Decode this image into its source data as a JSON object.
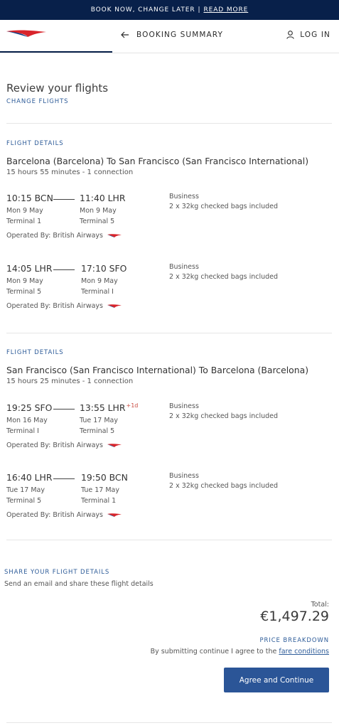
{
  "banner": {
    "text": "BOOK NOW, CHANGE LATER",
    "separator": "|",
    "link": "READ MORE"
  },
  "header": {
    "back_label": "BOOKING SUMMARY",
    "login_label": "LOG IN"
  },
  "review": {
    "title": "Review your flights",
    "change_link": "CHANGE FLIGHTS"
  },
  "colors": {
    "navy": "#08204a",
    "accent_blue": "#2e5c99",
    "button": "#2b5597",
    "next_day": "#c94a3f",
    "logo_red": "#d8242b"
  },
  "icons": {
    "back": "arrow-left-icon",
    "login": "user-icon",
    "logo": "speedmarque-logo",
    "carrier": "speedmarque-small-icon"
  },
  "outbound": {
    "section_label": "FLIGHT DETAILS",
    "route": "Barcelona (Barcelona) To San Francisco (San Francisco International)",
    "duration": "15 hours 55 minutes - 1 connection",
    "segments": [
      {
        "dep_time": "10:15 BCN",
        "arr_time": "11:40 LHR",
        "arr_next_day": "",
        "dep_date": "Mon 9 May",
        "arr_date": "Mon 9 May",
        "dep_terminal": "Terminal 1",
        "arr_terminal": "Terminal 5",
        "cabin": "Business",
        "bags": "2 x 32kg checked bags included",
        "operated_by": "Operated By: British Airways"
      },
      {
        "dep_time": "14:05 LHR",
        "arr_time": "17:10 SFO",
        "arr_next_day": "",
        "dep_date": "Mon 9 May",
        "arr_date": "Mon 9 May",
        "dep_terminal": "Terminal 5",
        "arr_terminal": "Terminal I",
        "cabin": "Business",
        "bags": "2 x 32kg checked bags included",
        "operated_by": "Operated By: British Airways"
      }
    ]
  },
  "inbound": {
    "section_label": "FLIGHT DETAILS",
    "route": "San Francisco (San Francisco International) To Barcelona (Barcelona)",
    "duration": "15 hours 25 minutes - 1 connection",
    "segments": [
      {
        "dep_time": "19:25 SFO",
        "arr_time": "13:55 LHR",
        "arr_next_day": "+1d",
        "dep_date": "Mon 16 May",
        "arr_date": "Tue 17 May",
        "dep_terminal": "Terminal I",
        "arr_terminal": "Terminal 5",
        "cabin": "Business",
        "bags": "2 x 32kg checked bags included",
        "operated_by": "Operated By: British Airways"
      },
      {
        "dep_time": "16:40 LHR",
        "arr_time": "19:50 BCN",
        "arr_next_day": "",
        "dep_date": "Tue 17 May",
        "arr_date": "Tue 17 May",
        "dep_terminal": "Terminal 5",
        "arr_terminal": "Terminal 1",
        "cabin": "Business",
        "bags": "2 x 32kg checked bags included",
        "operated_by": "Operated By: British Airways"
      }
    ]
  },
  "share": {
    "label": "SHARE YOUR FLIGHT DETAILS",
    "text": "Send an email and share these flight details"
  },
  "price": {
    "total_label": "Total:",
    "total_value": "€1,497.29",
    "breakdown_link": "PRICE BREAKDOWN",
    "terms_prefix": "By submitting continue I agree to the",
    "terms_link": "fare conditions"
  },
  "cta": {
    "label": "Agree and Continue"
  }
}
